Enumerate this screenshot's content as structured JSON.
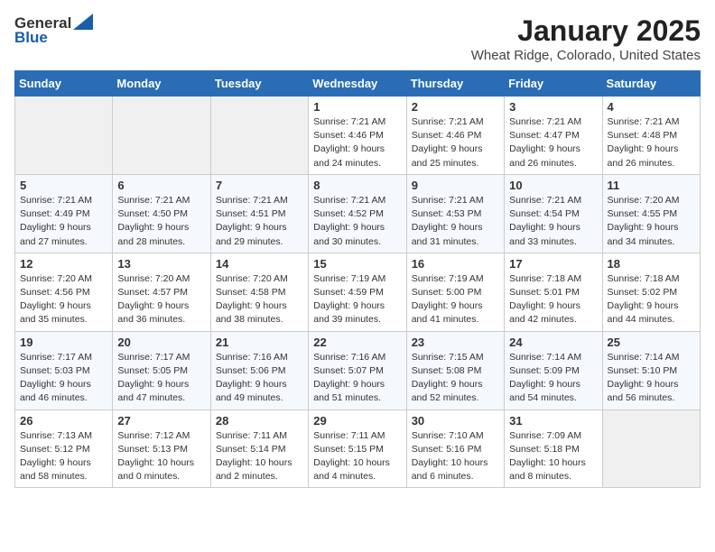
{
  "header": {
    "logo_general": "General",
    "logo_blue": "Blue",
    "month": "January 2025",
    "location": "Wheat Ridge, Colorado, United States"
  },
  "days_of_week": [
    "Sunday",
    "Monday",
    "Tuesday",
    "Wednesday",
    "Thursday",
    "Friday",
    "Saturday"
  ],
  "weeks": [
    [
      {
        "day": "",
        "content": ""
      },
      {
        "day": "",
        "content": ""
      },
      {
        "day": "",
        "content": ""
      },
      {
        "day": "1",
        "content": "Sunrise: 7:21 AM\nSunset: 4:46 PM\nDaylight: 9 hours\nand 24 minutes."
      },
      {
        "day": "2",
        "content": "Sunrise: 7:21 AM\nSunset: 4:46 PM\nDaylight: 9 hours\nand 25 minutes."
      },
      {
        "day": "3",
        "content": "Sunrise: 7:21 AM\nSunset: 4:47 PM\nDaylight: 9 hours\nand 26 minutes."
      },
      {
        "day": "4",
        "content": "Sunrise: 7:21 AM\nSunset: 4:48 PM\nDaylight: 9 hours\nand 26 minutes."
      }
    ],
    [
      {
        "day": "5",
        "content": "Sunrise: 7:21 AM\nSunset: 4:49 PM\nDaylight: 9 hours\nand 27 minutes."
      },
      {
        "day": "6",
        "content": "Sunrise: 7:21 AM\nSunset: 4:50 PM\nDaylight: 9 hours\nand 28 minutes."
      },
      {
        "day": "7",
        "content": "Sunrise: 7:21 AM\nSunset: 4:51 PM\nDaylight: 9 hours\nand 29 minutes."
      },
      {
        "day": "8",
        "content": "Sunrise: 7:21 AM\nSunset: 4:52 PM\nDaylight: 9 hours\nand 30 minutes."
      },
      {
        "day": "9",
        "content": "Sunrise: 7:21 AM\nSunset: 4:53 PM\nDaylight: 9 hours\nand 31 minutes."
      },
      {
        "day": "10",
        "content": "Sunrise: 7:21 AM\nSunset: 4:54 PM\nDaylight: 9 hours\nand 33 minutes."
      },
      {
        "day": "11",
        "content": "Sunrise: 7:20 AM\nSunset: 4:55 PM\nDaylight: 9 hours\nand 34 minutes."
      }
    ],
    [
      {
        "day": "12",
        "content": "Sunrise: 7:20 AM\nSunset: 4:56 PM\nDaylight: 9 hours\nand 35 minutes."
      },
      {
        "day": "13",
        "content": "Sunrise: 7:20 AM\nSunset: 4:57 PM\nDaylight: 9 hours\nand 36 minutes."
      },
      {
        "day": "14",
        "content": "Sunrise: 7:20 AM\nSunset: 4:58 PM\nDaylight: 9 hours\nand 38 minutes."
      },
      {
        "day": "15",
        "content": "Sunrise: 7:19 AM\nSunset: 4:59 PM\nDaylight: 9 hours\nand 39 minutes."
      },
      {
        "day": "16",
        "content": "Sunrise: 7:19 AM\nSunset: 5:00 PM\nDaylight: 9 hours\nand 41 minutes."
      },
      {
        "day": "17",
        "content": "Sunrise: 7:18 AM\nSunset: 5:01 PM\nDaylight: 9 hours\nand 42 minutes."
      },
      {
        "day": "18",
        "content": "Sunrise: 7:18 AM\nSunset: 5:02 PM\nDaylight: 9 hours\nand 44 minutes."
      }
    ],
    [
      {
        "day": "19",
        "content": "Sunrise: 7:17 AM\nSunset: 5:03 PM\nDaylight: 9 hours\nand 46 minutes."
      },
      {
        "day": "20",
        "content": "Sunrise: 7:17 AM\nSunset: 5:05 PM\nDaylight: 9 hours\nand 47 minutes."
      },
      {
        "day": "21",
        "content": "Sunrise: 7:16 AM\nSunset: 5:06 PM\nDaylight: 9 hours\nand 49 minutes."
      },
      {
        "day": "22",
        "content": "Sunrise: 7:16 AM\nSunset: 5:07 PM\nDaylight: 9 hours\nand 51 minutes."
      },
      {
        "day": "23",
        "content": "Sunrise: 7:15 AM\nSunset: 5:08 PM\nDaylight: 9 hours\nand 52 minutes."
      },
      {
        "day": "24",
        "content": "Sunrise: 7:14 AM\nSunset: 5:09 PM\nDaylight: 9 hours\nand 54 minutes."
      },
      {
        "day": "25",
        "content": "Sunrise: 7:14 AM\nSunset: 5:10 PM\nDaylight: 9 hours\nand 56 minutes."
      }
    ],
    [
      {
        "day": "26",
        "content": "Sunrise: 7:13 AM\nSunset: 5:12 PM\nDaylight: 9 hours\nand 58 minutes."
      },
      {
        "day": "27",
        "content": "Sunrise: 7:12 AM\nSunset: 5:13 PM\nDaylight: 10 hours\nand 0 minutes."
      },
      {
        "day": "28",
        "content": "Sunrise: 7:11 AM\nSunset: 5:14 PM\nDaylight: 10 hours\nand 2 minutes."
      },
      {
        "day": "29",
        "content": "Sunrise: 7:11 AM\nSunset: 5:15 PM\nDaylight: 10 hours\nand 4 minutes."
      },
      {
        "day": "30",
        "content": "Sunrise: 7:10 AM\nSunset: 5:16 PM\nDaylight: 10 hours\nand 6 minutes."
      },
      {
        "day": "31",
        "content": "Sunrise: 7:09 AM\nSunset: 5:18 PM\nDaylight: 10 hours\nand 8 minutes."
      },
      {
        "day": "",
        "content": ""
      }
    ]
  ]
}
